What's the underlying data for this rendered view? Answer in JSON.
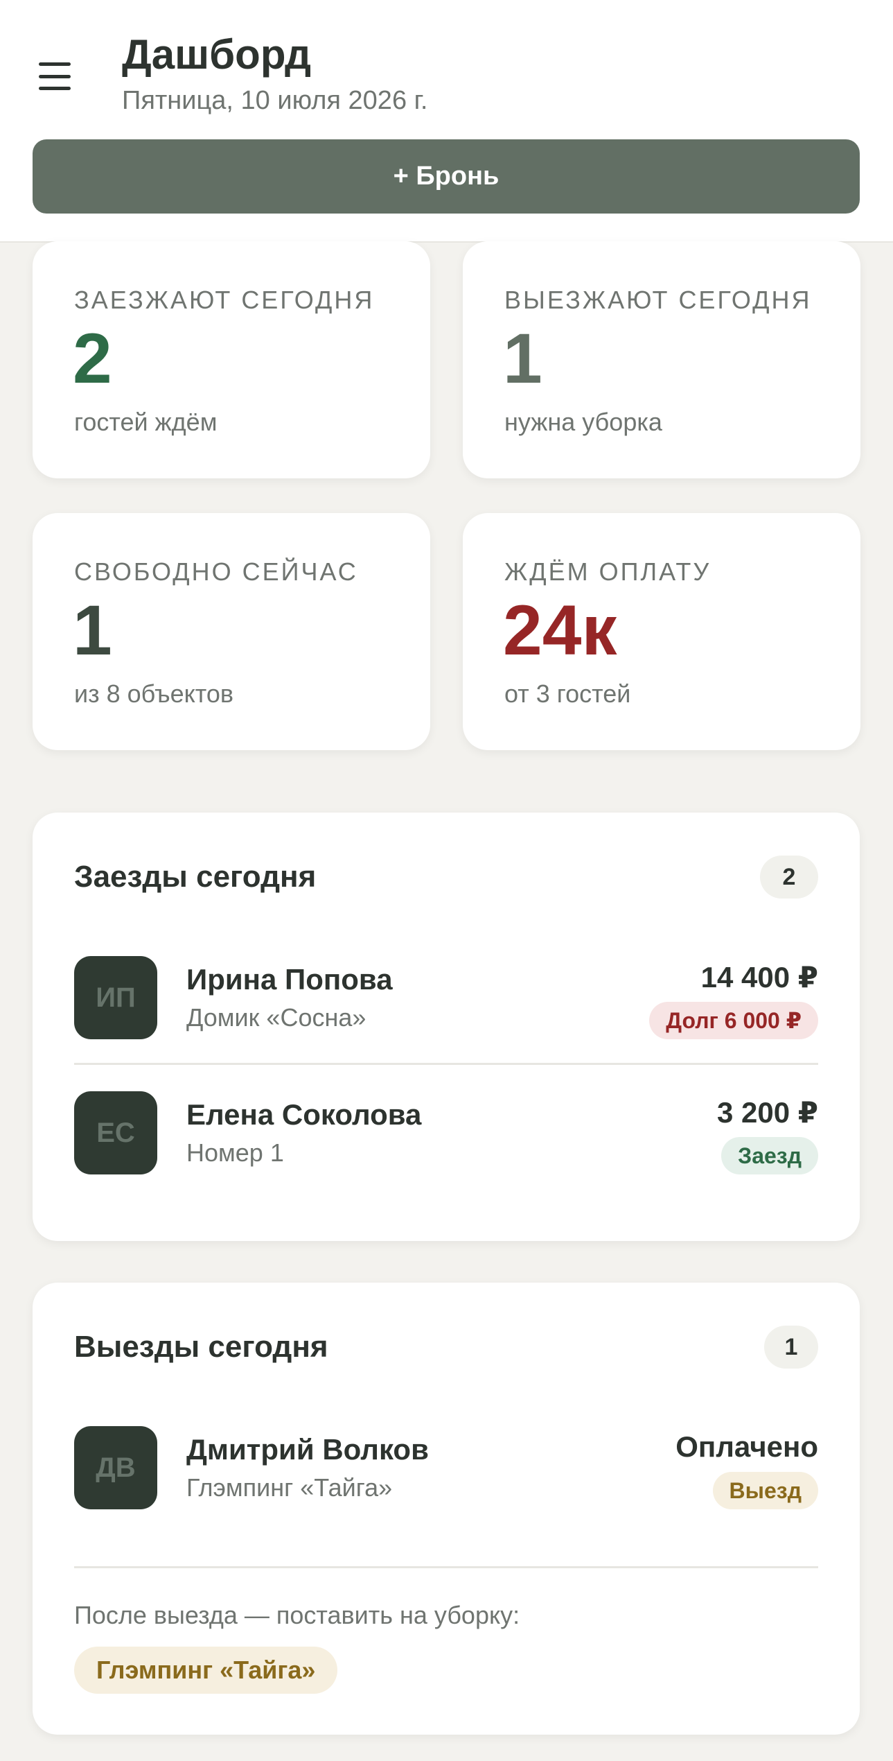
{
  "header": {
    "title": "Дашборд",
    "date": "Пятница, 10 июля 2026 г.",
    "add_booking_label": "+ Бронь"
  },
  "stats": [
    {
      "label": "ЗАЕЗЖАЮТ СЕГОДНЯ",
      "value": "2",
      "note": "гостей ждём",
      "color": "#2e6b47"
    },
    {
      "label": "ВЫЕЗЖАЮТ СЕГОДНЯ",
      "value": "1",
      "note": "нужна уборка",
      "color": "#626f64"
    },
    {
      "label": "СВОБОДНО СЕЙЧАС",
      "value": "1",
      "note": "из 8 объектов",
      "color": "#3d4a40"
    },
    {
      "label": "ЖДЁМ ОПЛАТУ",
      "value": "24к",
      "note": "от 3 гостей",
      "color": "#962626"
    }
  ],
  "arrivals": {
    "title": "Заезды сегодня",
    "count": "2",
    "items": [
      {
        "initials": "ИП",
        "name": "Ирина Попова",
        "place": "Домик «Сосна»",
        "amount": "14 400 ₽",
        "badge": "Долг 6 000 ₽",
        "badge_type": "debt"
      },
      {
        "initials": "ЕС",
        "name": "Елена Соколова",
        "place": "Номер 1",
        "amount": "3 200 ₽",
        "badge": "Заезд",
        "badge_type": "checkin"
      }
    ]
  },
  "departures": {
    "title": "Выезды сегодня",
    "count": "1",
    "items": [
      {
        "initials": "ДВ",
        "name": "Дмитрий Волков",
        "place": "Глэмпинг «Тайга»",
        "amount": "Оплачено",
        "badge": "Выезд",
        "badge_type": "checkout"
      }
    ],
    "after_checkout_text": "После выезда — поставить на уборку:",
    "cleaning_chip": "Глэмпинг «Тайга»"
  },
  "colors": {
    "accent": "#626f64",
    "positive": "#2e6b47",
    "danger": "#962626",
    "warning": "#8a6a1c",
    "avatar_bg": "#2f3a32"
  },
  "icons": {
    "menu": "hamburger-menu-icon"
  }
}
